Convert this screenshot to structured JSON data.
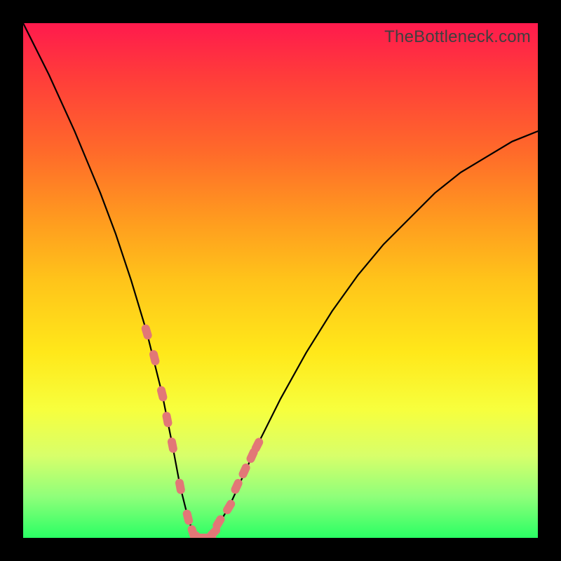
{
  "watermark": "TheBottleneck.com",
  "chart_data": {
    "type": "line",
    "title": "",
    "xlabel": "",
    "ylabel": "",
    "xlim": [
      0,
      100
    ],
    "ylim": [
      0,
      100
    ],
    "grid": false,
    "legend_position": "none",
    "series": [
      {
        "name": "bottleneck-curve",
        "x": [
          0,
          5,
          10,
          15,
          18,
          21,
          24,
          27,
          29,
          30.5,
          32,
          33,
          34,
          35,
          36,
          37,
          40,
          45,
          50,
          55,
          60,
          65,
          70,
          75,
          80,
          85,
          90,
          95,
          100
        ],
        "y": [
          100,
          90,
          79,
          67,
          59,
          50,
          40,
          28,
          18,
          10,
          4,
          1,
          0,
          0,
          0,
          1,
          6,
          17,
          27,
          36,
          44,
          51,
          57,
          62,
          67,
          71,
          74,
          77,
          79
        ],
        "color": "#000000"
      },
      {
        "name": "highlight-markers",
        "x": [
          24,
          25.5,
          27,
          28,
          29,
          30.5,
          32,
          33,
          34,
          35,
          36,
          37,
          38,
          40,
          41.5,
          43,
          44.5,
          45.5
        ],
        "y": [
          40,
          35,
          28,
          23,
          18,
          10,
          4,
          1,
          0,
          0,
          0,
          1,
          3,
          6,
          10,
          13,
          16,
          18
        ],
        "color": "#e27777",
        "marker": "pill"
      }
    ]
  }
}
